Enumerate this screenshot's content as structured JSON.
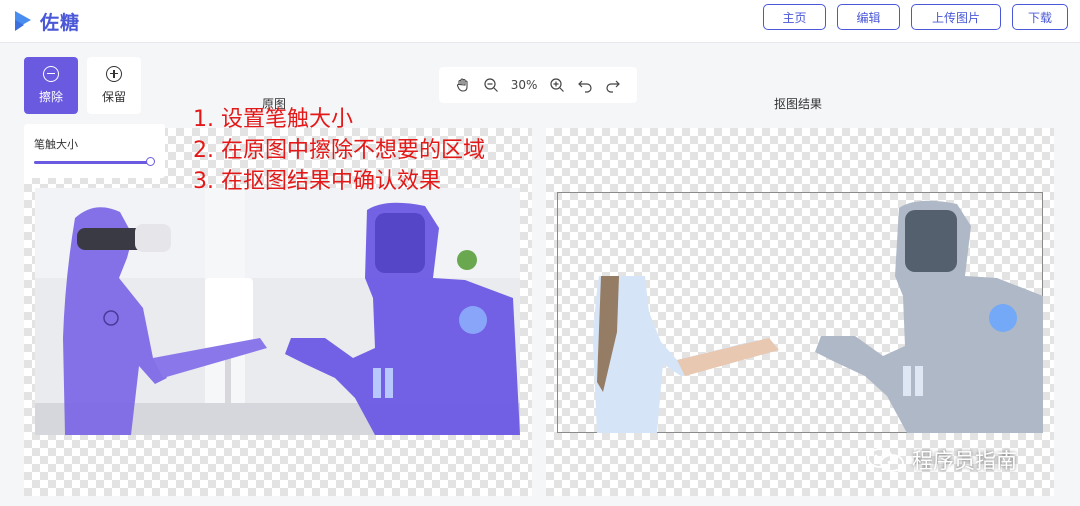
{
  "header": {
    "logo_text": "佐糖",
    "nav": [
      "主页",
      "编辑",
      "上传图片",
      "下载"
    ]
  },
  "tools": {
    "erase_label": "擦除",
    "keep_label": "保留",
    "active": "erase"
  },
  "brush": {
    "label": "笔触大小",
    "level_percent": 100
  },
  "zoom": {
    "level": "30%"
  },
  "canvas": {
    "original_title": "原图",
    "result_title": "抠图结果"
  },
  "instructions": [
    "1. 设置笔触大小",
    "2. 在原图中擦除不想要的区域",
    "3. 在抠图结果中确认效果"
  ],
  "watermark": "程序员指南",
  "colors": {
    "accent": "#6a5ae0",
    "brand": "#4a58d8",
    "annotation": "#e31818"
  }
}
